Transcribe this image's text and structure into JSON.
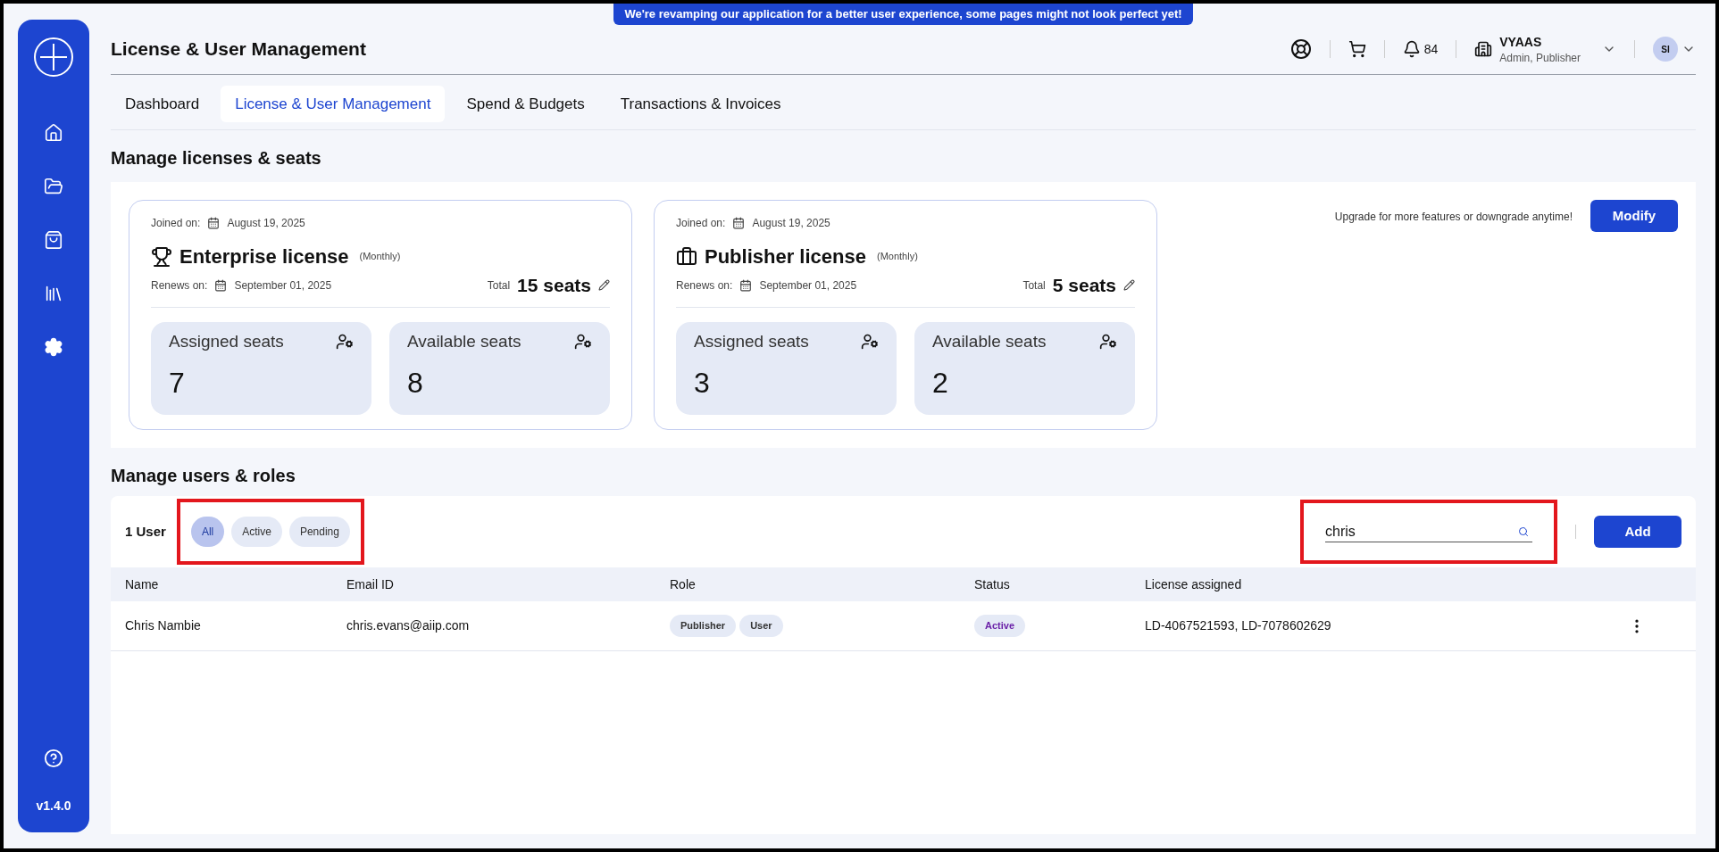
{
  "banner": "We're revamping our application for a better user experience, some pages might not look perfect yet!",
  "sidebar": {
    "items": [
      {
        "kind": "home",
        "selected": false
      },
      {
        "kind": "folder",
        "selected": false
      },
      {
        "kind": "bag",
        "selected": false
      },
      {
        "kind": "library",
        "selected": false
      },
      {
        "kind": "settings",
        "selected": true
      }
    ],
    "version": "v1.4.0"
  },
  "header": {
    "title": "License & User Management",
    "notifications": "84",
    "account": {
      "name": "VYAAS",
      "roles": "Admin, Publisher"
    },
    "avatar": "SI"
  },
  "tabs": [
    {
      "label": "Dashboard",
      "selected": false
    },
    {
      "label": "License & User Management",
      "selected": true
    },
    {
      "label": "Spend & Budgets",
      "selected": false
    },
    {
      "label": "Transactions & Invoices",
      "selected": false
    }
  ],
  "licenses": {
    "title": "Manage licenses & seats",
    "upgrade_note": "Upgrade for more features or downgrade anytime!",
    "modify_button": "Modify",
    "cards": [
      {
        "kind": "enterprise",
        "joined_label": "Joined on:",
        "joined_date": "August 19, 2025",
        "name": "Enterprise license",
        "period": "(Monthly)",
        "renews_label": "Renews on:",
        "renews_date": "September 01, 2025",
        "total_label": "Total",
        "total": "15 seats",
        "stats": [
          {
            "label": "Assigned seats",
            "value": "7"
          },
          {
            "label": "Available seats",
            "value": "8"
          }
        ]
      },
      {
        "kind": "publisher",
        "joined_label": "Joined on:",
        "joined_date": "August 19, 2025",
        "name": "Publisher license",
        "period": "(Monthly)",
        "renews_label": "Renews on:",
        "renews_date": "September 01, 2025",
        "total_label": "Total",
        "total": "5 seats",
        "stats": [
          {
            "label": "Assigned seats",
            "value": "3"
          },
          {
            "label": "Available seats",
            "value": "2"
          }
        ]
      }
    ]
  },
  "users": {
    "title": "Manage users & roles",
    "count": "1 User",
    "filters": [
      {
        "label": "All",
        "selected": true
      },
      {
        "label": "Active",
        "selected": false
      },
      {
        "label": "Pending",
        "selected": false
      }
    ],
    "search": {
      "value": "chris"
    },
    "add_button": "Add",
    "table": {
      "columns": [
        "Name",
        "Email ID",
        "Role",
        "Status",
        "License assigned"
      ],
      "rows": [
        {
          "name": "Chris Nambie",
          "email": "chris.evans@aiip.com",
          "roles": [
            "Publisher",
            "User"
          ],
          "status": "Active",
          "licenses": "LD-4067521593, LD-7078602629"
        }
      ]
    }
  }
}
